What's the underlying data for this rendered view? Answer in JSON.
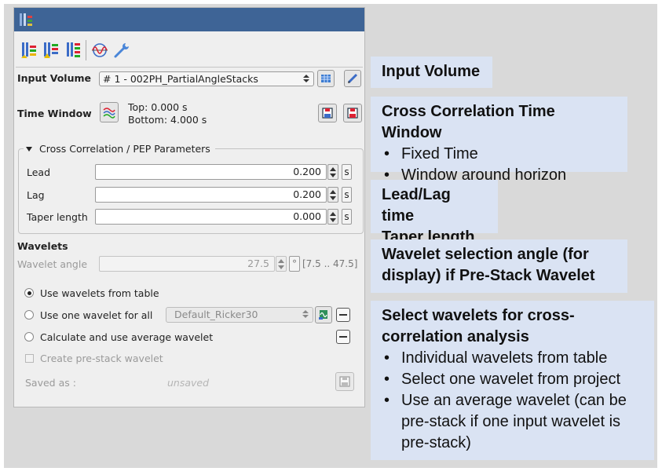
{
  "dialog": {
    "toolbar": {
      "icons": [
        "stack-add-icon",
        "stack-pick-icon",
        "stack-list-icon",
        "wavelet-plot-icon",
        "wrench-icon"
      ]
    },
    "input_volume": {
      "label": "Input Volume",
      "value": "# 1 - 002PH_PartialAngleStacks"
    },
    "time_window": {
      "label": "Time Window",
      "top": "Top: 0.000 s",
      "bottom": "Bottom: 4.000 s"
    },
    "cc_group": {
      "title": "Cross Correlation / PEP Parameters",
      "rows": [
        {
          "label": "Lead",
          "value": "0.200",
          "unit": "s"
        },
        {
          "label": "Lag",
          "value": "0.200",
          "unit": "s"
        },
        {
          "label": "Taper length",
          "value": "0.000",
          "unit": "s"
        }
      ]
    },
    "wavelets": {
      "heading": "Wavelets",
      "angle_label": "Wavelet angle",
      "angle_value": "27.5",
      "angle_unit": "°",
      "angle_range": "[7.5 .. 47.5]",
      "options": [
        {
          "label": "Use wavelets from table",
          "checked": true
        },
        {
          "label": "Use one wavelet for all",
          "checked": false
        },
        {
          "label": "Calculate and use average wavelet",
          "checked": false
        }
      ],
      "one_wavelet_value": "Default_Ricker30",
      "prestack_label": "Create pre-stack wavelet",
      "saved_as_label": "Saved as :",
      "saved_as_value": "unsaved"
    }
  },
  "callouts": {
    "input_volume": {
      "title": "Input Volume"
    },
    "time_window": {
      "title": "Cross Correlation Time Window",
      "items": [
        "Fixed Time",
        "Window around horizon"
      ]
    },
    "lead_lag": {
      "line1": "Lead/Lag time",
      "line2": "Taper length"
    },
    "wavelet_angle": {
      "line1": "Wavelet selection angle (for",
      "line2": "display) if Pre-Stack Wavelet"
    },
    "select_wavelets": {
      "line1": "Select wavelets for cross-",
      "line2": "correlation analysis",
      "items": [
        "Individual wavelets from table",
        "Select one wavelet from project",
        "Use an average wavelet (can be",
        "pre-stack if one input wavelet is",
        "pre-stack)"
      ]
    }
  },
  "colors": {
    "callout_bg": "#dae3f3",
    "titlebar": "#3e6496",
    "slide_bg": "#d9d9d9"
  }
}
